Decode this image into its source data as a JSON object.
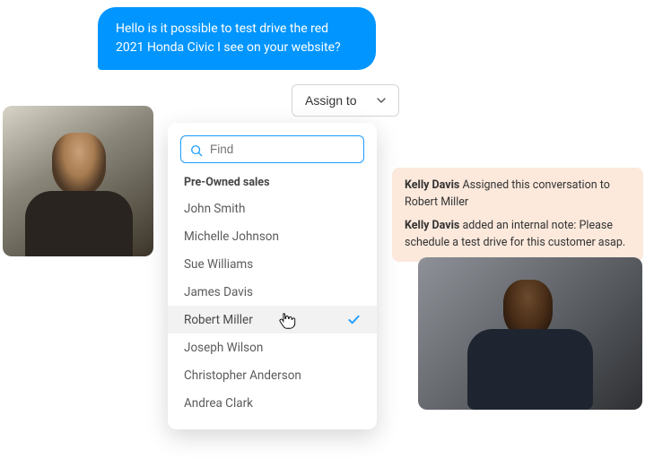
{
  "chat": {
    "message": "Hello is it possible to test drive the red 2021 Honda Civic I see on your website?"
  },
  "assign_button": {
    "label": "Assign to"
  },
  "dropdown": {
    "search_placeholder": "Find",
    "group_label": "Pre-Owned sales",
    "options": [
      {
        "name": "John Smith",
        "selected": false
      },
      {
        "name": "Michelle Johnson",
        "selected": false
      },
      {
        "name": "Sue Williams",
        "selected": false
      },
      {
        "name": "James Davis",
        "selected": false
      },
      {
        "name": "Robert Miller",
        "selected": true
      },
      {
        "name": "Joseph Wilson",
        "selected": false
      },
      {
        "name": "Christopher Anderson",
        "selected": false
      },
      {
        "name": "Andrea Clark",
        "selected": false
      }
    ]
  },
  "notes": {
    "n1": {
      "author": "Kelly Davis",
      "text": " Assigned this conversation to Robert Miller"
    },
    "n2": {
      "author": "Kelly Davis",
      "text": " added an internal note: Please schedule a test drive for this customer asap."
    }
  }
}
